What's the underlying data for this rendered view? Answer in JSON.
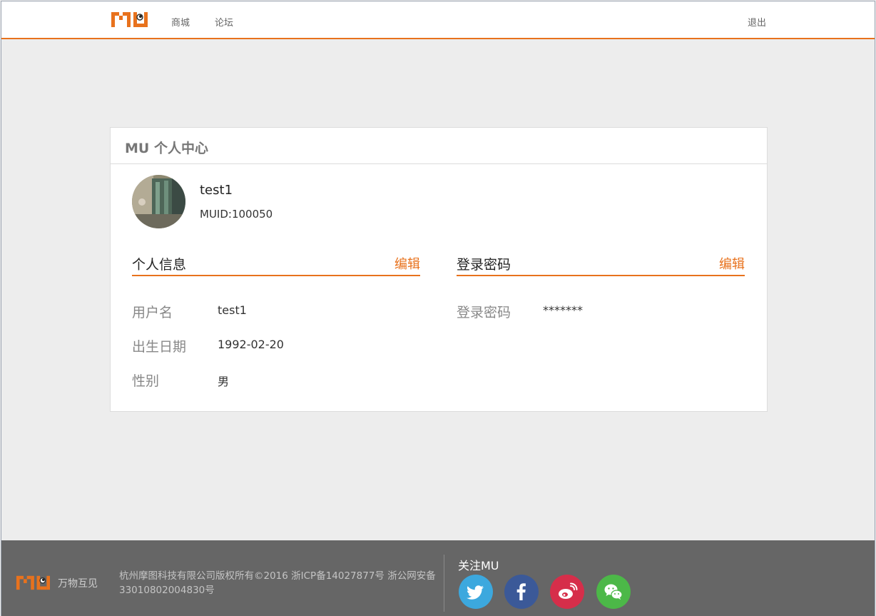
{
  "header": {
    "logo": "MU",
    "nav": {
      "shop": "商城",
      "forum": "论坛"
    },
    "logout": "退出"
  },
  "card": {
    "title": "MU 个人中心",
    "user": {
      "username": "test1",
      "muid_label": "MUID:",
      "muid": "100050"
    },
    "info_section": {
      "title": "个人信息",
      "edit": "编辑",
      "fields": [
        {
          "label": "用户名",
          "value": "test1"
        },
        {
          "label": "出生日期",
          "value": "1992-02-20"
        },
        {
          "label": "性别",
          "value": "男"
        }
      ]
    },
    "password_section": {
      "title": "登录密码",
      "edit": "编辑",
      "fields": [
        {
          "label": "登录密码",
          "value": "*******"
        }
      ]
    }
  },
  "footer": {
    "logo": "MU",
    "slogan": "万物互见",
    "copyright": "杭州摩图科技有限公司版权所有©2016 浙ICP备14027877号 浙公网安备 33010802004830号",
    "follow_title": "关注MU",
    "social_icons": [
      "twitter-icon",
      "facebook-icon",
      "weibo-icon",
      "wechat-icon"
    ]
  },
  "colors": {
    "accent": "#e8721d",
    "footer_bg": "#666666",
    "page_bg": "#ededed"
  }
}
